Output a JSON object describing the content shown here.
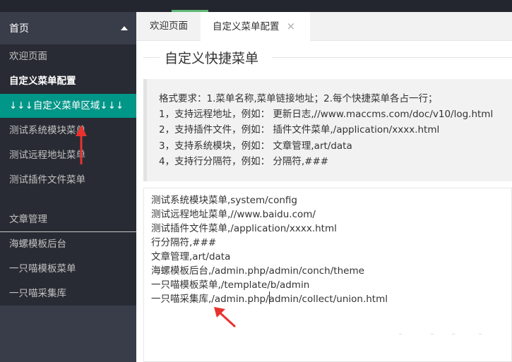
{
  "sidebar": {
    "header": "首页",
    "items": [
      {
        "label": "欢迎页面"
      },
      {
        "label": "自定义菜单配置"
      },
      {
        "label": "↓↓↓自定义菜单区域↓↓↓"
      },
      {
        "label": "测试系统模块菜单"
      },
      {
        "label": "测试远程地址菜单"
      },
      {
        "label": "测试插件文件菜单"
      },
      {
        "label": "文章管理"
      },
      {
        "label": "海螺模板后台"
      },
      {
        "label": "一只喵模板菜单"
      },
      {
        "label": "一只喵采集库"
      }
    ]
  },
  "tabs": [
    {
      "label": "欢迎页面"
    },
    {
      "label": "自定义菜单配置",
      "close": "×"
    }
  ],
  "main": {
    "legend": "自定义快捷菜单",
    "help_lines": [
      "格式要求：1.菜单名称,菜单链接地址；2.每个快捷菜单各占一行；",
      "1，支持远程地址，例如： 更新日志,//www.maccms.com/doc/v10/log.html",
      "2，支持插件文件，例如： 插件文件菜单,/application/xxxx.html",
      "3，支持系统模块，例如： 文章管理,art/data",
      "4，支持行分隔符，例如： 分隔符,###"
    ],
    "editor_lines": [
      "测试系统模块菜单,system/config",
      "测试远程地址菜单,//www.baidu.com/",
      "测试插件文件菜单,/application/xxxx.html",
      "行分隔符,###",
      "文章管理,art/data",
      "海螺模板后台,/admin.php/admin/conch/theme",
      "一只喵模板菜单,/template/b/admin",
      "一只喵采集库,/admin.php/admin/collect/union.html"
    ]
  },
  "colors": {
    "sidebar_bg": "#393d49",
    "sidebar_block_bg": "#282b33",
    "active_item": "#009688",
    "tab_accent": "#5fb878",
    "annotation_arrow": "#e8322d"
  },
  "icons": {
    "sidebar_caret": "caret-up-icon",
    "tab_close": "close-icon"
  }
}
